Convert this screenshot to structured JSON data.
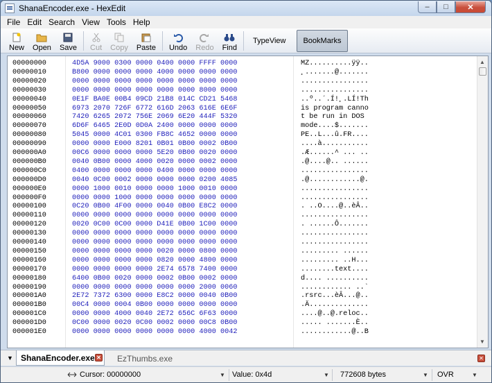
{
  "window": {
    "title": "ShanaEncoder.exe - HexEdit",
    "controls": {
      "minimize": "–",
      "maximize": "□",
      "close": "✕"
    }
  },
  "menu": [
    "File",
    "Edit",
    "Search",
    "View",
    "Tools",
    "Help"
  ],
  "toolbar": {
    "new": "New",
    "open": "Open",
    "save": "Save",
    "cut": "Cut",
    "copy": "Copy",
    "paste": "Paste",
    "undo": "Undo",
    "redo": "Redo",
    "find": "Find",
    "typeview": "TypeView",
    "bookmarks": "BookMarks"
  },
  "hex_rows": [
    {
      "offset": "00000000",
      "hex": "4D5A 9000 0300 0000 0400 0000 FFFF 0000",
      "ascii": "MZ..........ÿÿ.."
    },
    {
      "offset": "00000010",
      "hex": "B800 0000 0000 0000 4000 0000 0000 0000",
      "ascii": "¸.......@......."
    },
    {
      "offset": "00000020",
      "hex": "0000 0000 0000 0000 0000 0000 0000 0000",
      "ascii": "................"
    },
    {
      "offset": "00000030",
      "hex": "0000 0000 0000 0000 0000 0000 8000 0000",
      "ascii": "................"
    },
    {
      "offset": "00000040",
      "hex": "0E1F BA0E 00B4 09CD 21B8 014C CD21 5468",
      "ascii": "..º..´.Í!¸.LÍ!Th"
    },
    {
      "offset": "00000050",
      "hex": "6973 2070 726F 6772 616D 2063 616E 6E6F",
      "ascii": "is program canno"
    },
    {
      "offset": "00000060",
      "hex": "7420 6265 2072 756E 2069 6E20 444F 5320",
      "ascii": "t be run in DOS "
    },
    {
      "offset": "00000070",
      "hex": "6D6F 6465 2E0D 0D0A 2400 0000 0000 0000",
      "ascii": "mode....$......."
    },
    {
      "offset": "00000080",
      "hex": "5045 0000 4C01 0300 FB8C 4652 0000 0000",
      "ascii": "PE..L...û.FR...."
    },
    {
      "offset": "00000090",
      "hex": "0000 0000 E000 8201 0B01 0B00 0002 0B00",
      "ascii": "....à..........."
    },
    {
      "offset": "000000A0",
      "hex": "00C6 0000 0000 0000 5E20 0B00 0020 0000",
      "ascii": ".Æ......^ ... .."
    },
    {
      "offset": "000000B0",
      "hex": "0040 0B00 0000 4000 0020 0000 0002 0000",
      "ascii": ".@....@.. ......"
    },
    {
      "offset": "000000C0",
      "hex": "0400 0000 0000 0000 0400 0000 0000 0000",
      "ascii": "................"
    },
    {
      "offset": "000000D0",
      "hex": "0040 0C00 0002 0000 0000 0000 0200 4085",
      "ascii": ".@............@."
    },
    {
      "offset": "000000E0",
      "hex": "0000 1000 0010 0000 0000 1000 0010 0000",
      "ascii": "................"
    },
    {
      "offset": "000000F0",
      "hex": "0000 0000 1000 0000 0000 0000 0000 0000",
      "ascii": "................"
    },
    {
      "offset": "00000100",
      "hex": "0C20 0B00 4F00 0000 0040 0B00 E8C2 0000",
      "ascii": ". ..O....@..èÂ.."
    },
    {
      "offset": "00000110",
      "hex": "0000 0000 0000 0000 0000 0000 0000 0000",
      "ascii": "................"
    },
    {
      "offset": "00000120",
      "hex": "0020 0C00 0C00 0000 D41E 0B00 1C00 0000",
      "ascii": ". ......Ô......."
    },
    {
      "offset": "00000130",
      "hex": "0000 0000 0000 0000 0000 0000 0000 0000",
      "ascii": "................"
    },
    {
      "offset": "00000140",
      "hex": "0000 0000 0000 0000 0000 0000 0000 0000",
      "ascii": "................"
    },
    {
      "offset": "00000150",
      "hex": "0000 0000 0000 0000 0020 0000 0800 0000",
      "ascii": "......... ......"
    },
    {
      "offset": "00000160",
      "hex": "0000 0000 0000 0000 0820 0000 4800 0000",
      "ascii": "......... ..H..."
    },
    {
      "offset": "00000170",
      "hex": "0000 0000 0000 0000 2E74 6578 7400 0000",
      "ascii": "........text...."
    },
    {
      "offset": "00000180",
      "hex": "6400 0B00 0020 0000 0002 0B00 0002 0000",
      "ascii": "d.... .........."
    },
    {
      "offset": "00000190",
      "hex": "0000 0000 0000 0000 0000 0000 2000 0060",
      "ascii": "............ ..`"
    },
    {
      "offset": "000001A0",
      "hex": "2E72 7372 6300 0000 E8C2 0000 0040 0B00",
      "ascii": ".rsrc...èÂ...@.."
    },
    {
      "offset": "000001B0",
      "hex": "00C4 0000 0004 0B00 0000 0000 0000 0000",
      "ascii": ".Ä.............."
    },
    {
      "offset": "000001C0",
      "hex": "0000 0000 4000 0040 2E72 656C 6F63 0000",
      "ascii": "....@..@.reloc.."
    },
    {
      "offset": "000001D0",
      "hex": "0C00 0000 0020 0C00 0002 0000 00C8 0B00",
      "ascii": "..... .......È.."
    },
    {
      "offset": "000001E0",
      "hex": "0000 0000 0000 0000 0000 0000 4000 0042",
      "ascii": "............@..B"
    }
  ],
  "tabs": {
    "active": "ShanaEncoder.exe",
    "inactive": "EzThumbs.exe",
    "close_glyph": "✕",
    "list_glyph": "▼"
  },
  "status": {
    "cursor": "Cursor: 00000000",
    "value": "Value: 0x4d",
    "size": "772608 bytes",
    "mode": "OVR"
  },
  "colors": {
    "hex_text": "#2222bb",
    "window_frame": "#cfdcec",
    "close_button": "#c8503d"
  }
}
